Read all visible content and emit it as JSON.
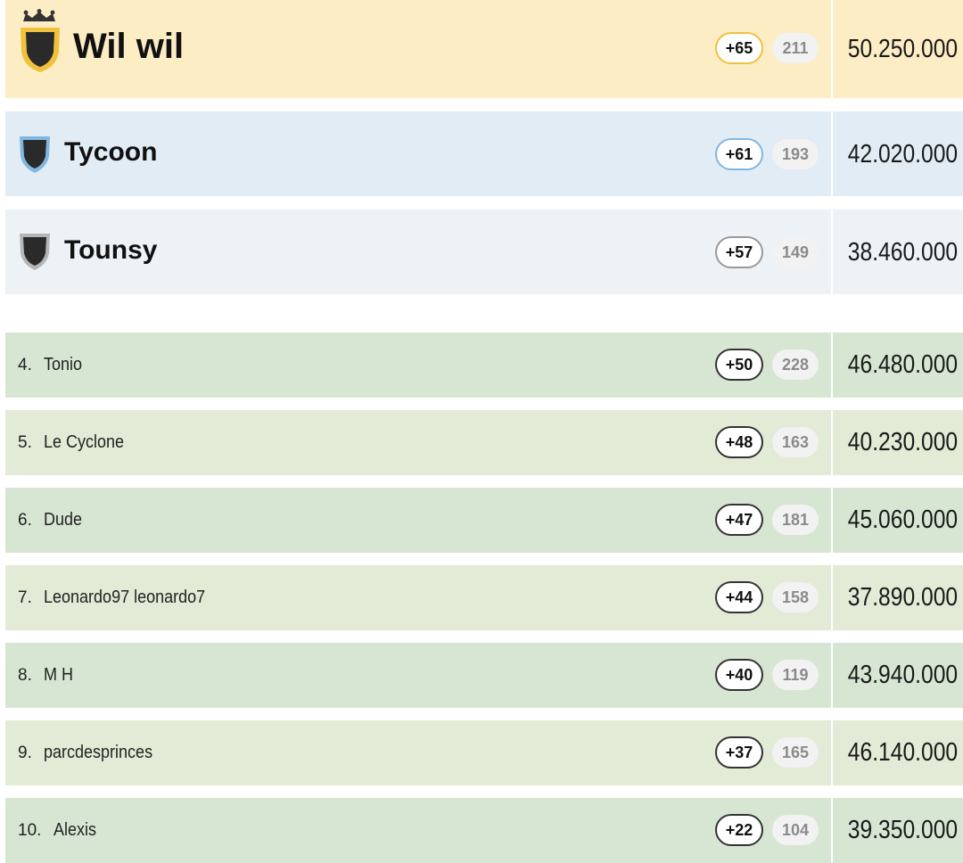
{
  "leaderboard": {
    "top": [
      {
        "name": "Wil wil",
        "points": "+65",
        "count": "211",
        "value": "50.250.000",
        "bg": "#fcedc4",
        "accent": "#f0c13c"
      },
      {
        "name": "Tycoon",
        "points": "+61",
        "count": "193",
        "value": "42.020.000",
        "bg": "#e2ecf5",
        "accent": "#7fb7e2"
      },
      {
        "name": "Tounsy",
        "points": "+57",
        "count": "149",
        "value": "38.460.000",
        "bg": "#edf2f7",
        "accent": "#a9a9a9"
      }
    ],
    "rest": [
      {
        "rank": "4.",
        "name": "Tonio",
        "points": "+50",
        "count": "228",
        "value": "46.480.000",
        "bg": "#d7e6d3"
      },
      {
        "rank": "5.",
        "name": "Le Cyclone",
        "points": "+48",
        "count": "163",
        "value": "40.230.000",
        "bg": "#e1ebd6"
      },
      {
        "rank": "6.",
        "name": "Dude",
        "points": "+47",
        "count": "181",
        "value": "45.060.000",
        "bg": "#d7e6d3"
      },
      {
        "rank": "7.",
        "name": "Leonardo97 leonardo7",
        "points": "+44",
        "count": "158",
        "value": "37.890.000",
        "bg": "#e1ebd6"
      },
      {
        "rank": "8.",
        "name": "M H",
        "points": "+40",
        "count": "119",
        "value": "43.940.000",
        "bg": "#d7e6d3"
      },
      {
        "rank": "9.",
        "name": "parcdesprinces",
        "points": "+37",
        "count": "165",
        "value": "46.140.000",
        "bg": "#e1ebd6"
      },
      {
        "rank": "10.",
        "name": "Alexis",
        "points": "+22",
        "count": "104",
        "value": "39.350.000",
        "bg": "#d7e6d3"
      }
    ]
  }
}
